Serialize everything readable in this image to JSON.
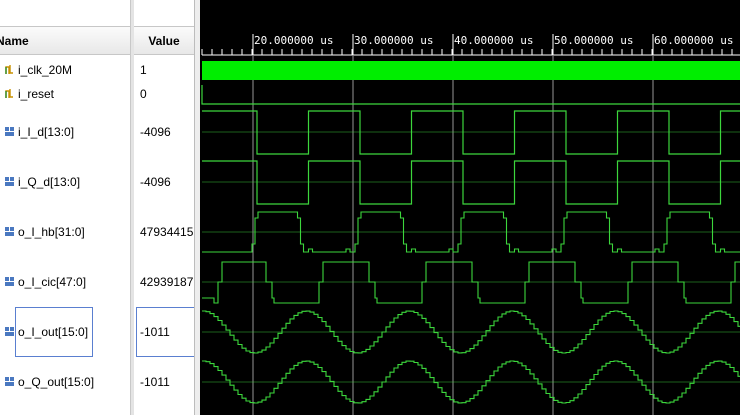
{
  "columns": {
    "name_header": "Name",
    "value_header": "Value"
  },
  "ruler": {
    "ticks": [
      "20.000000 us",
      "30.000000 us",
      "40.000000 us",
      "50.000000 us",
      "60.000000 us"
    ]
  },
  "signals": [
    {
      "name": "i_clk_20M",
      "value": "1",
      "icon": "bit-signal-icon"
    },
    {
      "name": "i_reset",
      "value": "0",
      "icon": "bit-signal-icon"
    },
    {
      "name": "i_I_d[13:0]",
      "value": "-4096",
      "icon": "bus-signal-icon"
    },
    {
      "name": "i_Q_d[13:0]",
      "value": "-4096",
      "icon": "bus-signal-icon"
    },
    {
      "name": "o_I_hb[31:0]",
      "value": "47934415",
      "icon": "bus-signal-icon"
    },
    {
      "name": "o_I_cic[47:0]",
      "value": "42939187",
      "icon": "bus-signal-icon"
    },
    {
      "name": "o_I_out[15:0]",
      "value": "-1011",
      "icon": "bus-signal-icon"
    },
    {
      "name": "o_Q_out[15:0]",
      "value": "-1011",
      "icon": "bus-signal-icon"
    }
  ],
  "colors": {
    "wave": "#3cd63c",
    "clock_fill": "#00ee00",
    "cursor": "#c8c8c8",
    "waveform_bg": "#000000",
    "selection": "#5a7fd0"
  }
}
